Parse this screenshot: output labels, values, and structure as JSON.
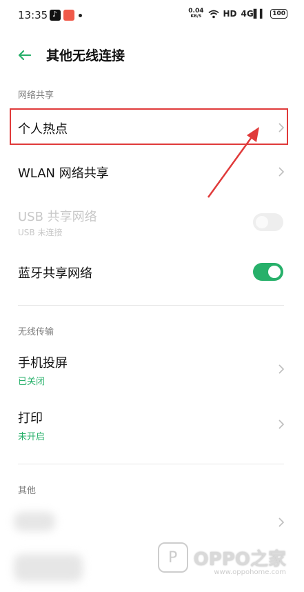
{
  "status_bar": {
    "time": "13:35",
    "speed_value": "0.04",
    "speed_unit": "KB/S",
    "hd_label": "HD",
    "signal_label": "4G",
    "battery": "100"
  },
  "header": {
    "back_icon": "back-arrow-icon",
    "title": "其他无线连接"
  },
  "sections": {
    "network_sharing": {
      "label": "网络共享",
      "items": [
        {
          "title": "个人热点"
        },
        {
          "title": "WLAN 网络共享"
        },
        {
          "title": "USB 共享网络",
          "subtitle": "USB 未连接",
          "toggle_on": false,
          "disabled": true
        },
        {
          "title": "蓝牙共享网络",
          "toggle_on": true
        }
      ]
    },
    "wireless_transfer": {
      "label": "无线传输",
      "items": [
        {
          "title": "手机投屏",
          "subtitle": "已关闭"
        },
        {
          "title": "打印",
          "subtitle": "未开启"
        }
      ]
    },
    "other": {
      "label": "其他"
    }
  },
  "watermark": {
    "brand": "OPPO之家",
    "url": "www.oppohome.com"
  },
  "colors": {
    "accent": "#27b06a",
    "highlight": "#e03a3a"
  }
}
